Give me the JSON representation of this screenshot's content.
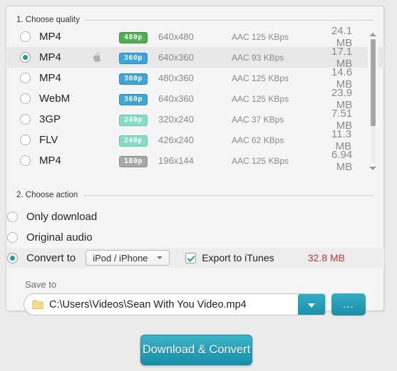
{
  "quality_section": {
    "caption": "1. Choose quality",
    "rows": [
      {
        "selected": false,
        "format": "MP4",
        "apple": false,
        "badge": "480p",
        "badge_color": "green",
        "resolution": "640x480",
        "audio": "AAC 125  KBps",
        "size": "24.1 MB"
      },
      {
        "selected": true,
        "format": "MP4",
        "apple": true,
        "badge": "360p",
        "badge_color": "blue",
        "resolution": "640x360",
        "audio": "AAC 93  KBps",
        "size": "17.1 MB"
      },
      {
        "selected": false,
        "format": "MP4",
        "apple": false,
        "badge": "360p",
        "badge_color": "blue",
        "resolution": "480x360",
        "audio": "AAC 125  KBps",
        "size": "14.6 MB"
      },
      {
        "selected": false,
        "format": "WebM",
        "apple": false,
        "badge": "360p",
        "badge_color": "blue",
        "resolution": "640x360",
        "audio": "AAC 125  KBps",
        "size": "23.9 MB"
      },
      {
        "selected": false,
        "format": "3GP",
        "apple": false,
        "badge": "240p",
        "badge_color": "teal",
        "resolution": "320x240",
        "audio": "AAC 37  KBps",
        "size": "7.51 MB"
      },
      {
        "selected": false,
        "format": "FLV",
        "apple": false,
        "badge": "240p",
        "badge_color": "teal",
        "resolution": "426x240",
        "audio": "AAC 62  KBps",
        "size": "11.3 MB"
      },
      {
        "selected": false,
        "format": "MP4",
        "apple": false,
        "badge": "180p",
        "badge_color": "gray",
        "resolution": "196x144",
        "audio": "AAC 125  KBps",
        "size": "6.94 MB"
      }
    ]
  },
  "action_section": {
    "caption": "2. Choose action",
    "only_download_label": "Only download",
    "original_audio_label": "Original audio",
    "convert_to_label": "Convert to",
    "device_combo_value": "iPod / iPhone",
    "export_checkbox_label": "Export to iTunes",
    "export_checked": true,
    "convert_size": "32.8 MB",
    "selected_action": "convert_to"
  },
  "save_section": {
    "label": "Save to",
    "path": "C:\\Users\\Videos\\Sean With You Video.mp4",
    "browse_label": "..."
  },
  "footer": {
    "download_button_label": "Download & Convert"
  },
  "colors": {
    "accent": "#1b9aaa",
    "button_gradient_top": "#3bb3c8",
    "button_gradient_bottom": "#1690ab",
    "size_warning": "#c0392b",
    "badge_green": "#4caf50",
    "badge_blue": "#3aa6dd",
    "badge_teal": "#84ddc6",
    "badge_gray": "#a8a8a8",
    "panel_bg": "#f5f5f5",
    "page_bg": "#ebebeb"
  }
}
